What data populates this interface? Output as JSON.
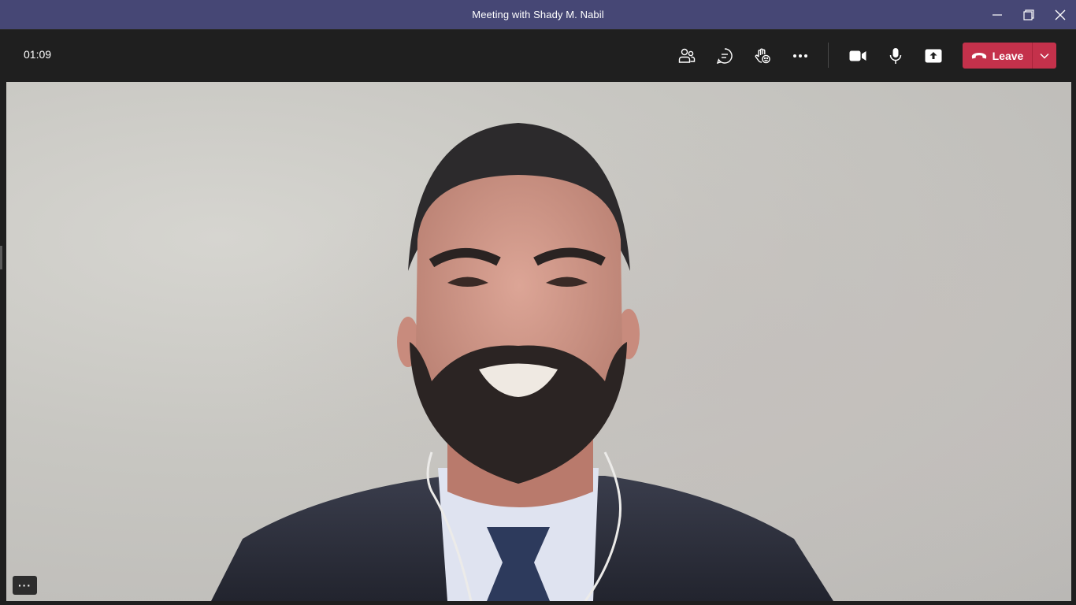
{
  "window": {
    "title": "Meeting with Shady M. Nabil",
    "controls": [
      "minimize-icon",
      "restore-icon",
      "close-icon"
    ]
  },
  "toolbar": {
    "timer": "01:09",
    "buttons": [
      "people-icon",
      "chat-icon",
      "reactions-icon",
      "more-actions-icon",
      "camera-icon",
      "microphone-icon",
      "share-screen-icon"
    ],
    "leave_label": "Leave"
  },
  "video": {
    "participant_feed": "video-feed",
    "overflow_label": "···"
  },
  "colors": {
    "titlebar": "#464775",
    "toolbar": "#1f1f1f",
    "leave": "#c4314b"
  }
}
